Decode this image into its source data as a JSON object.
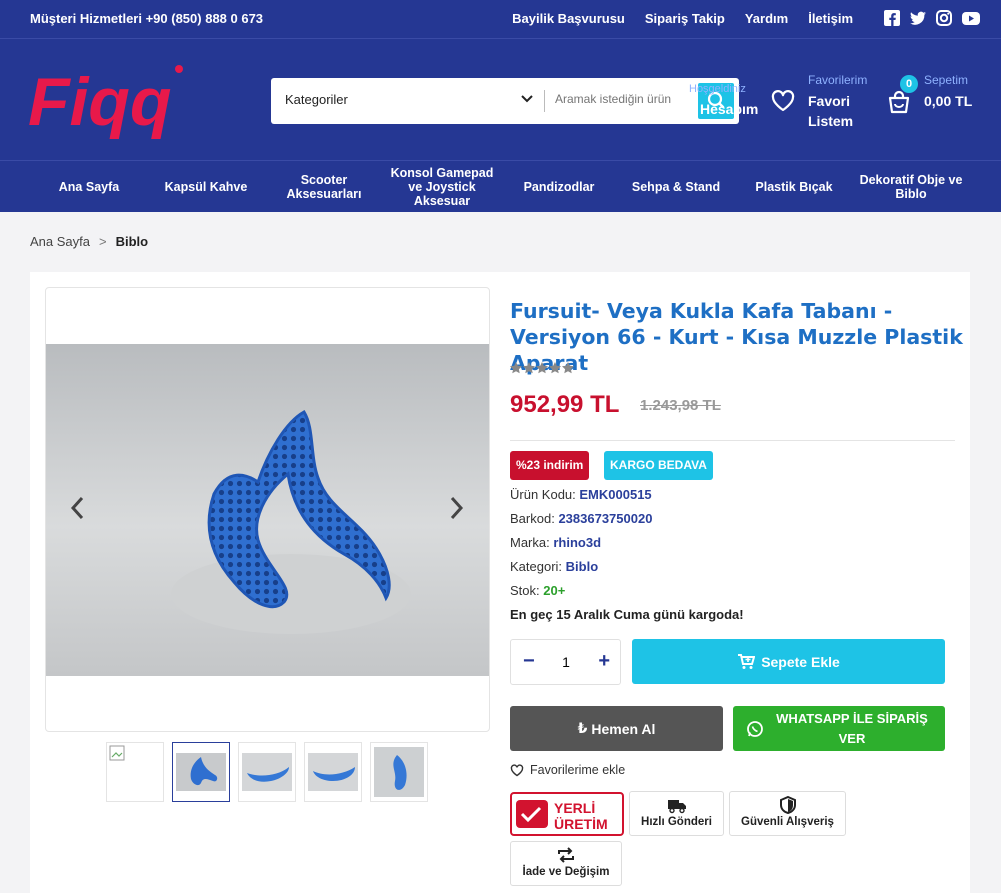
{
  "topbar": {
    "phone": "Müşteri Hizmetleri +90 (850) 888 0 673",
    "links": [
      "Bayilik Başvurusu",
      "Sipariş Takip",
      "Yardım",
      "İletişim"
    ],
    "social": [
      "facebook-icon",
      "twitter-icon",
      "instagram-icon",
      "youtube-icon"
    ]
  },
  "header": {
    "logo_text": "Fiqq",
    "search": {
      "category_label": "Kategoriler",
      "placeholder": "Aramak istediğin ürün"
    },
    "account": {
      "greeting": "Hoşgeldiniz",
      "label": "Hesabım"
    },
    "favorites": {
      "small": "Favorilerim",
      "big": "Favori Listem"
    },
    "cart": {
      "count": "0",
      "small": "Sepetim",
      "big": "0,00 TL"
    }
  },
  "nav": {
    "items": [
      "Ana Sayfa",
      "Kapsül Kahve",
      "Scooter Aksesuarları",
      "Konsol Gamepad ve Joystick Aksesuar",
      "Pandizodlar",
      "Sehpa & Stand",
      "Plastik Bıçak",
      "Dekoratif Obje ve Biblo"
    ]
  },
  "breadcrumb": {
    "home": "Ana Sayfa",
    "sep": ">",
    "current": "Biblo"
  },
  "product": {
    "title": "Fursuit- Veya Kukla Kafa Tabanı - Versiyon 66 - Kurt - Kısa Muzzle Plastik Aparat",
    "rating": 0,
    "rating_max": 5,
    "price": "952,99 TL",
    "old_price": "1.243,98 TL",
    "discount_badge": "%23 indirim",
    "cargo_badge": "KARGO BEDAVA",
    "specs": {
      "code_label": "Ürün Kodu:",
      "code": "EMK000515",
      "barcode_label": "Barkod:",
      "barcode": "2383673750020",
      "brand_label": "Marka:",
      "brand": "rhino3d",
      "category_label": "Kategori:",
      "category": "Biblo",
      "stock_label": "Stok:",
      "stock": "20+"
    },
    "shipping_note": "En geç 15 Aralık Cuma günü kargoda!",
    "quantity": "1",
    "add_to_cart": "Sepete Ekle",
    "buy_now": "Hemen Al",
    "whatsapp": "WHATSAPP İLE SİPARİŞ VER",
    "add_favorite": "Favorilerime ekle"
  },
  "features": {
    "local": {
      "line1": "YERLİ",
      "line2": "ÜRETİM"
    },
    "fast": "Hızlı Gönderi",
    "secure": "Güvenli Alışveriş",
    "return": "İade ve Değişim"
  },
  "colors": {
    "brand_navy": "#253793",
    "accent_cyan": "#1ec3e6",
    "title_blue": "#1e6fc4",
    "price_red": "#c8102e",
    "whatsapp_green": "#2daf2d"
  }
}
